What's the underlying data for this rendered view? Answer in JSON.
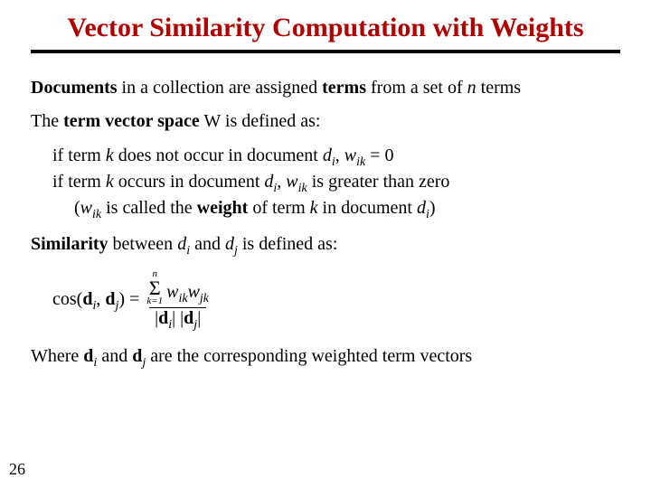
{
  "title": "Vector Similarity Computation with Weights",
  "line1_pre": "Documents",
  "line1_mid": " in a collection are assigned ",
  "line1_terms": "terms",
  "line1_post1": " from a set of ",
  "line1_n": "n",
  "line1_post2": " terms",
  "line2_pre": "The ",
  "line2_tvs": "term vector space",
  "line2_post": " W is defined as:",
  "cond1_a": "if term ",
  "cond1_k": "k",
  "cond1_b": " does not occur in document ",
  "cond1_d": "d",
  "cond1_i": "i",
  "cond1_c": ", ",
  "cond1_w": "w",
  "cond1_ik": "ik",
  "cond1_eq": " = 0",
  "cond2_a": "if term ",
  "cond2_b": " occurs in document ",
  "cond2_c": ", ",
  "cond2_d": " is greater than zero",
  "cond3_a": "(",
  "cond3_b": " is called the ",
  "cond3_weight": "weight",
  "cond3_c": " of term ",
  "cond3_d": " in document ",
  "cond3_e": ")",
  "sim_pre": "Similarity",
  "sim_mid1": " between ",
  "sim_mid2": " and ",
  "sim_post": " is defined as:",
  "lhs_a": "cos(",
  "lhs_b": ", ",
  "lhs_c": ") = ",
  "sigma_top": "n",
  "sigma": "Σ",
  "sigma_bot": "k=1",
  "num_w1": "w",
  "num_ik": "ik",
  "num_w2": "w",
  "num_jk": "jk",
  "den_a": "|",
  "den_b": "| |",
  "den_c": "|",
  "where_a": "Where ",
  "where_b": " and ",
  "where_c": " are the corresponding weighted term vectors",
  "d": "d",
  "sub_i": "i",
  "sub_j": "j",
  "page": "26"
}
